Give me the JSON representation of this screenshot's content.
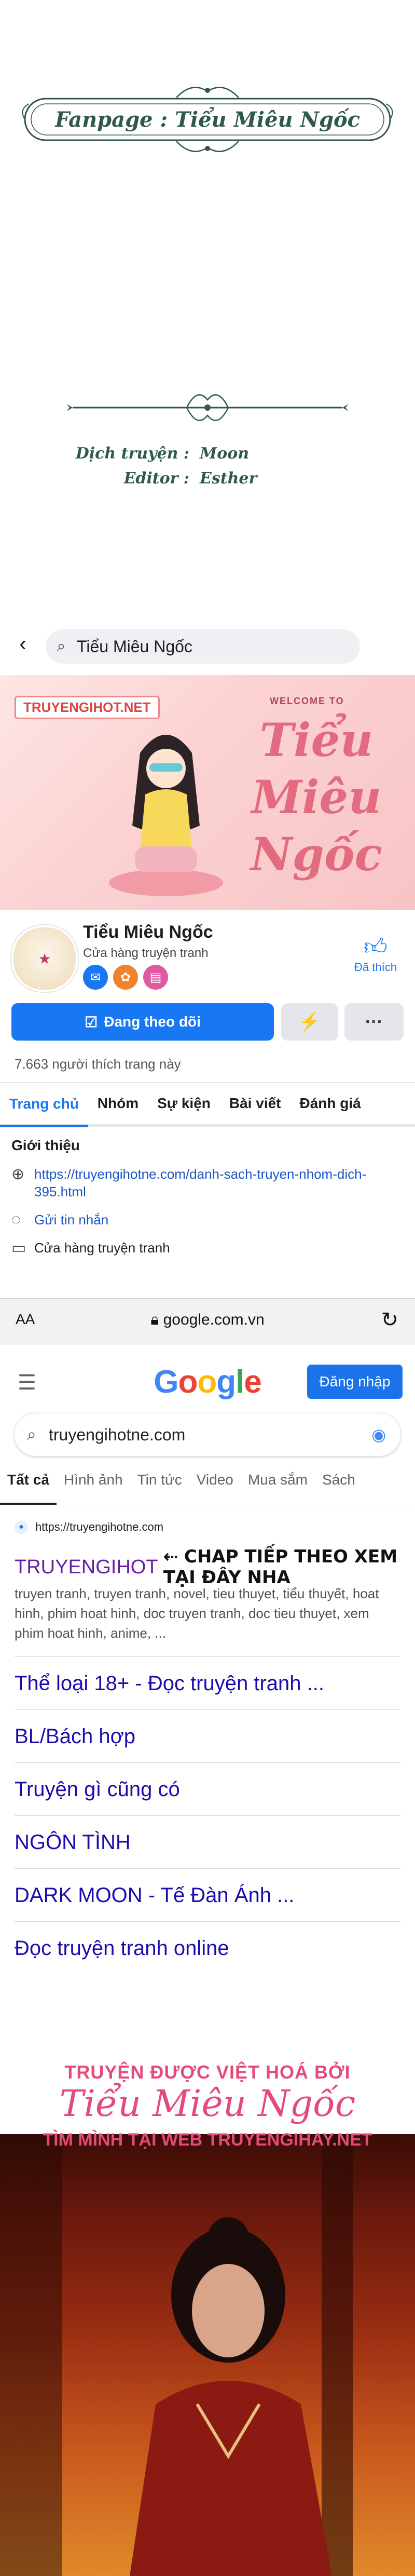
{
  "banner": {
    "fanpage_title": "Fanpage : Tiểu Miêu Ngốc",
    "credits": [
      {
        "role": "Dịch truyện :",
        "name": "Moon"
      },
      {
        "role": "Editor :",
        "name": "Esther"
      }
    ]
  },
  "facebook": {
    "search_query": "Tiểu Miêu Ngốc",
    "cover": {
      "site_tag": "TRUYENGIHOT.NET",
      "welcome": "WELCOME TO",
      "script_title": "Tiểu Miêu Ngốc"
    },
    "page_name": "Tiểu Miêu Ngốc",
    "category": "Cửa hàng truyện tranh",
    "liked_label": "Đã thích",
    "follow_button": "Đang theo dõi",
    "likes_count": "7.663 người thích trang này",
    "tabs": [
      "Trang chủ",
      "Nhóm",
      "Sự kiện",
      "Bài viết",
      "Đánh giá"
    ],
    "intro": {
      "heading": "Giới thiệu",
      "link": "https://truyengihotne.com/danh-sach-truyen-nhom-dich-395.html",
      "message": "Gửi tin nhắn",
      "category": "Cửa hàng truyện tranh"
    }
  },
  "safari": {
    "aa": "AA",
    "domain": "google.com.vn"
  },
  "google": {
    "logo": "Google",
    "signin": "Đăng nhập",
    "query": "truyengihotne.com",
    "tabs": [
      "Tất cả",
      "Hình ảnh",
      "Tin tức",
      "Video",
      "Mua sắm",
      "Sách"
    ],
    "result": {
      "site_url": "https://truyengihotne.com",
      "title": "TRUYENGIHOT",
      "annotation": "⇠ CHAP TIẾP THEO XEM TẠI ĐÂY NHA",
      "snippet": "truyen tranh, truyen tranh, novel, tieu thuyet, tiểu thuyết, hoat hinh, phim hoat hinh, doc truyen tranh, doc tieu thuyet, xem phim hoat hinh, anime, ..."
    },
    "sitelinks": [
      "Thể loại 18+ - Đọc truyện tranh ...",
      "BL/Bách hợp",
      "Truyện gì cũng có",
      "NGÔN TÌNH",
      "DARK MOON - Tế Đàn Ánh ...",
      "Đọc truyện tranh online"
    ]
  },
  "manga": {
    "line1": "TRUYỆN ĐƯỢC VIỆT HOÁ BỞI",
    "line2": "Tiểu Miêu Ngốc",
    "line3": "TÌM MÌNH TẠI WEB TRUYENGIHAY.NET"
  },
  "colors": {
    "facebook_blue": "#1877f2",
    "google_link": "#1a0dab",
    "visited_title": "#681da8",
    "banner_green": "#2f5a4a",
    "pink": "#e54b79"
  }
}
